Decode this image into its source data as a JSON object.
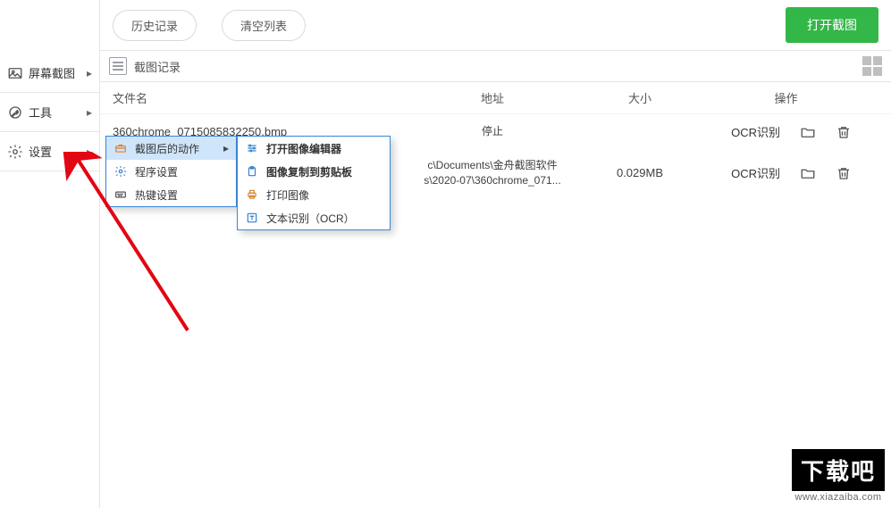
{
  "sidebar": {
    "items": [
      {
        "label": "屏幕截图"
      },
      {
        "label": "工具"
      },
      {
        "label": "设置"
      }
    ]
  },
  "topbar": {
    "history": "历史记录",
    "clear": "清空列表",
    "open_capture": "打开截图"
  },
  "panel": {
    "title": "截图记录"
  },
  "table": {
    "headers": {
      "name": "文件名",
      "addr": "地址",
      "size": "大小",
      "ops": "操作"
    },
    "rows": [
      {
        "name": "360chrome_0715085832250.bmp",
        "addr": "停止",
        "addr2": "",
        "size": "",
        "ocr": "OCR识别"
      },
      {
        "name": "",
        "addr": "c\\Documents\\金舟截图软件",
        "addr2": "s\\2020-07\\360chrome_071...",
        "size": "0.029MB",
        "ocr": "OCR识别"
      }
    ]
  },
  "menu1": {
    "items": [
      {
        "label": "截图后的动作"
      },
      {
        "label": "程序设置"
      },
      {
        "label": "热键设置"
      }
    ]
  },
  "menu2": {
    "items": [
      {
        "label": "打开图像编辑器"
      },
      {
        "label": "图像复制到剪贴板"
      },
      {
        "label": "打印图像"
      },
      {
        "label": "文本识别（OCR）"
      }
    ]
  },
  "watermark": {
    "brand": "下载吧",
    "url": "www.xiazaiba.com"
  }
}
